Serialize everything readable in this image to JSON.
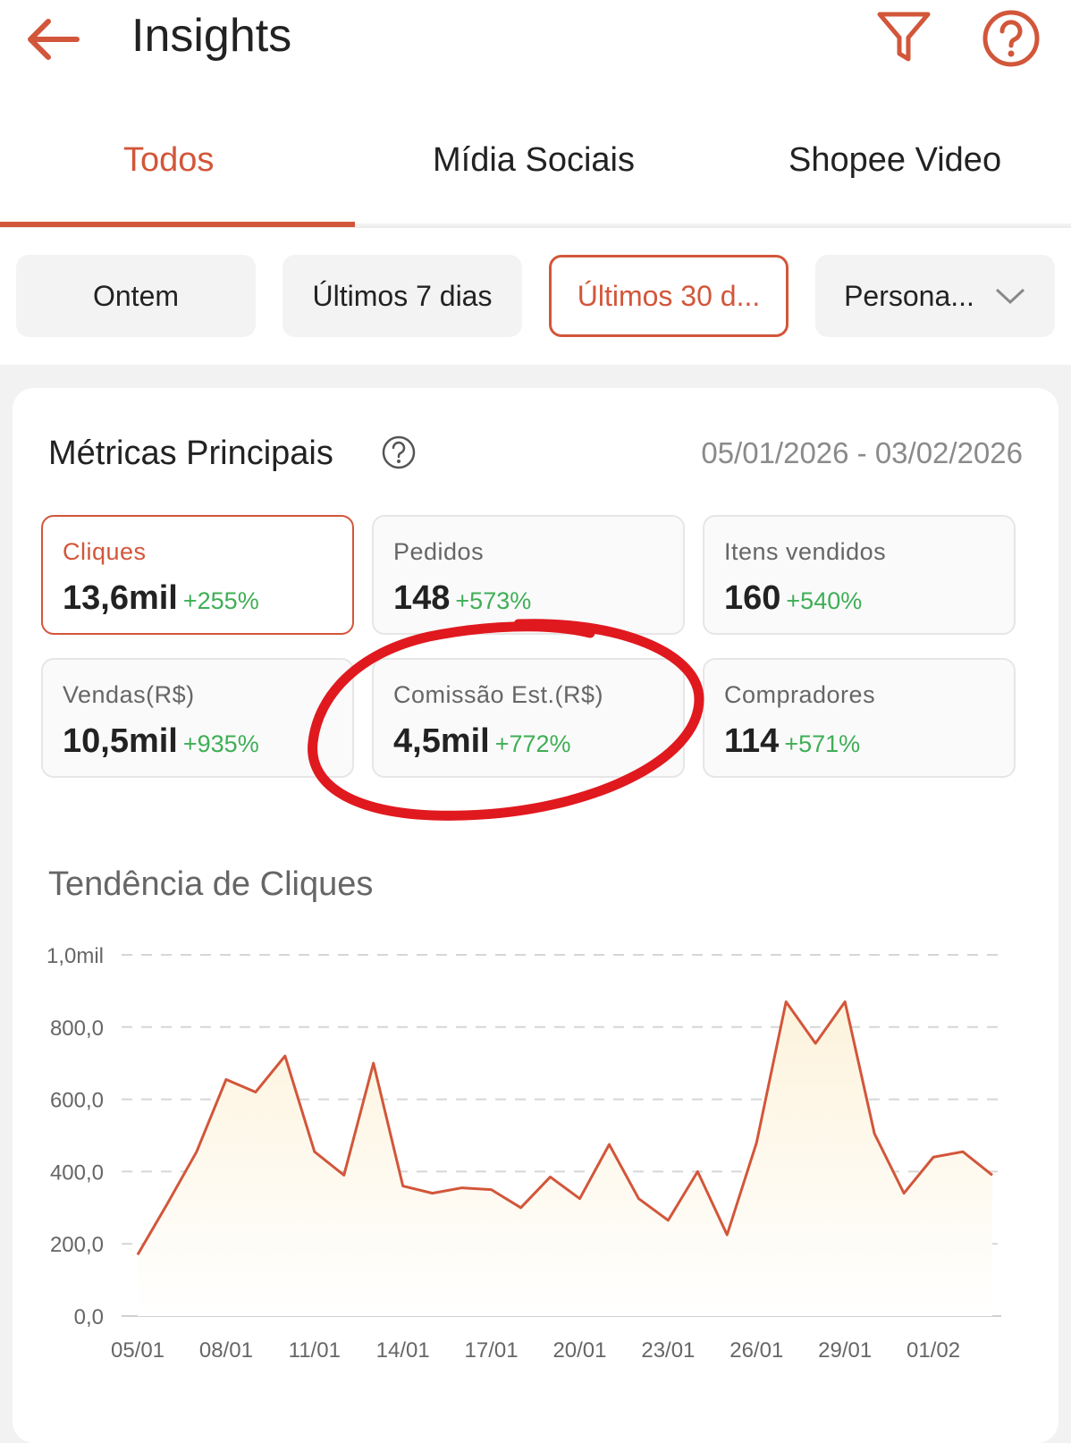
{
  "header": {
    "title": "Insights",
    "back_icon": "arrow-left-icon",
    "filter_icon": "funnel-icon",
    "help_icon": "question-circle-icon",
    "accent": "#d2563a"
  },
  "tabs": [
    {
      "label": "Todos",
      "active": true
    },
    {
      "label": "Mídia Sociais"
    },
    {
      "label": "Shopee Video"
    }
  ],
  "periods": [
    {
      "label": "Ontem"
    },
    {
      "label": "Últimos 7 dias"
    },
    {
      "label": "Últimos 30 d...",
      "active": true
    },
    {
      "label": "Persona..."
    }
  ],
  "metrics_section": {
    "title": "Métricas Principais",
    "date_range": "05/01/2026 - 03/02/2026",
    "items": [
      {
        "label": "Cliques",
        "value": "13,6mil",
        "change": "+255%",
        "active": true
      },
      {
        "label": "Pedidos",
        "value": "148",
        "change": "+573%"
      },
      {
        "label": "Itens vendidos",
        "value": "160",
        "change": "+540%"
      },
      {
        "label": "Vendas(R$)",
        "value": "10,5mil",
        "change": "+935%"
      },
      {
        "label": "Comissão Est.(R$)",
        "value": "4,5mil",
        "change": "+772%"
      },
      {
        "label": "Compradores",
        "value": "114",
        "change": "+571%"
      }
    ]
  },
  "chart_title": "Tendência de Cliques",
  "chart_data": {
    "type": "area",
    "title": "Tendência de Cliques",
    "y_tick_labels": [
      "0,0",
      "200,0",
      "400,0",
      "600,0",
      "800,0",
      "1,0mil"
    ],
    "ylim": [
      0,
      1000
    ],
    "x_tick_labels": [
      "05/01",
      "08/01",
      "11/01",
      "14/01",
      "17/01",
      "20/01",
      "23/01",
      "26/01",
      "29/01",
      "01/02"
    ],
    "x": [
      "05/01",
      "06/01",
      "07/01",
      "08/01",
      "09/01",
      "10/01",
      "11/01",
      "12/01",
      "13/01",
      "14/01",
      "15/01",
      "16/01",
      "17/01",
      "18/01",
      "19/01",
      "20/01",
      "21/01",
      "22/01",
      "23/01",
      "24/01",
      "25/01",
      "26/01",
      "27/01",
      "28/01",
      "29/01",
      "30/01",
      "31/01",
      "01/02",
      "02/02",
      "03/02"
    ],
    "values": [
      170,
      310,
      455,
      655,
      620,
      720,
      455,
      390,
      700,
      360,
      340,
      355,
      350,
      300,
      385,
      325,
      475,
      325,
      265,
      400,
      225,
      480,
      870,
      755,
      870,
      505,
      340,
      440,
      455,
      390
    ],
    "grid": true,
    "color": "#d2563a",
    "fill": "#fdf3dc"
  }
}
